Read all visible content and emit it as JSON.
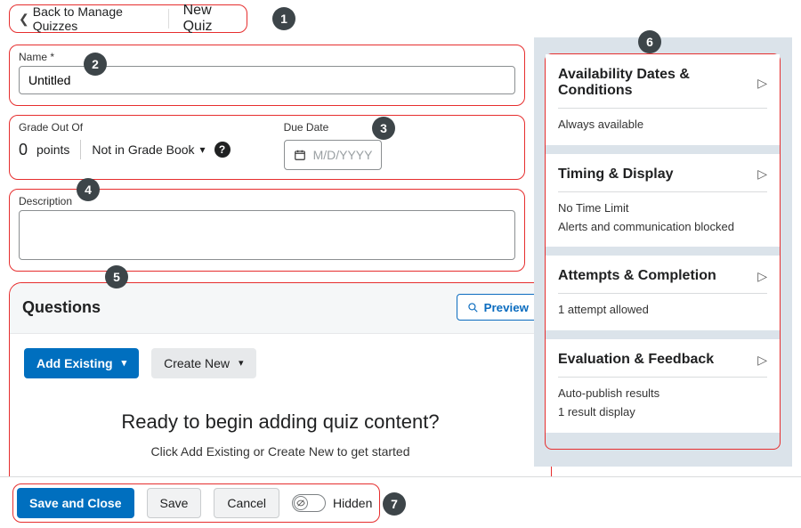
{
  "header": {
    "back_label": "Back to Manage Quizzes",
    "page_title": "New Quiz"
  },
  "name": {
    "label": "Name *",
    "value": "Untitled"
  },
  "grade": {
    "label": "Grade Out Of",
    "points_value": "0",
    "points_unit": "points",
    "dropdown_label": "Not in Grade Book"
  },
  "due": {
    "label": "Due Date",
    "placeholder": "M/D/YYYY"
  },
  "description": {
    "label": "Description"
  },
  "questions": {
    "heading": "Questions",
    "preview_label": "Preview",
    "add_existing_label": "Add Existing",
    "create_new_label": "Create New",
    "empty_title": "Ready to begin adding quiz content?",
    "empty_sub": "Click Add Existing or Create New to get started"
  },
  "right": {
    "cards": [
      {
        "title": "Availability Dates & Conditions",
        "lines": [
          "Always available"
        ]
      },
      {
        "title": "Timing & Display",
        "lines": [
          "No Time Limit",
          "Alerts and communication blocked"
        ]
      },
      {
        "title": "Attempts & Completion",
        "lines": [
          "1 attempt allowed"
        ]
      },
      {
        "title": "Evaluation & Feedback",
        "lines": [
          "Auto-publish results",
          "1 result display"
        ]
      }
    ]
  },
  "footer": {
    "save_close": "Save and Close",
    "save": "Save",
    "cancel": "Cancel",
    "hidden": "Hidden"
  },
  "badges": [
    "1",
    "2",
    "3",
    "4",
    "5",
    "6",
    "7"
  ]
}
